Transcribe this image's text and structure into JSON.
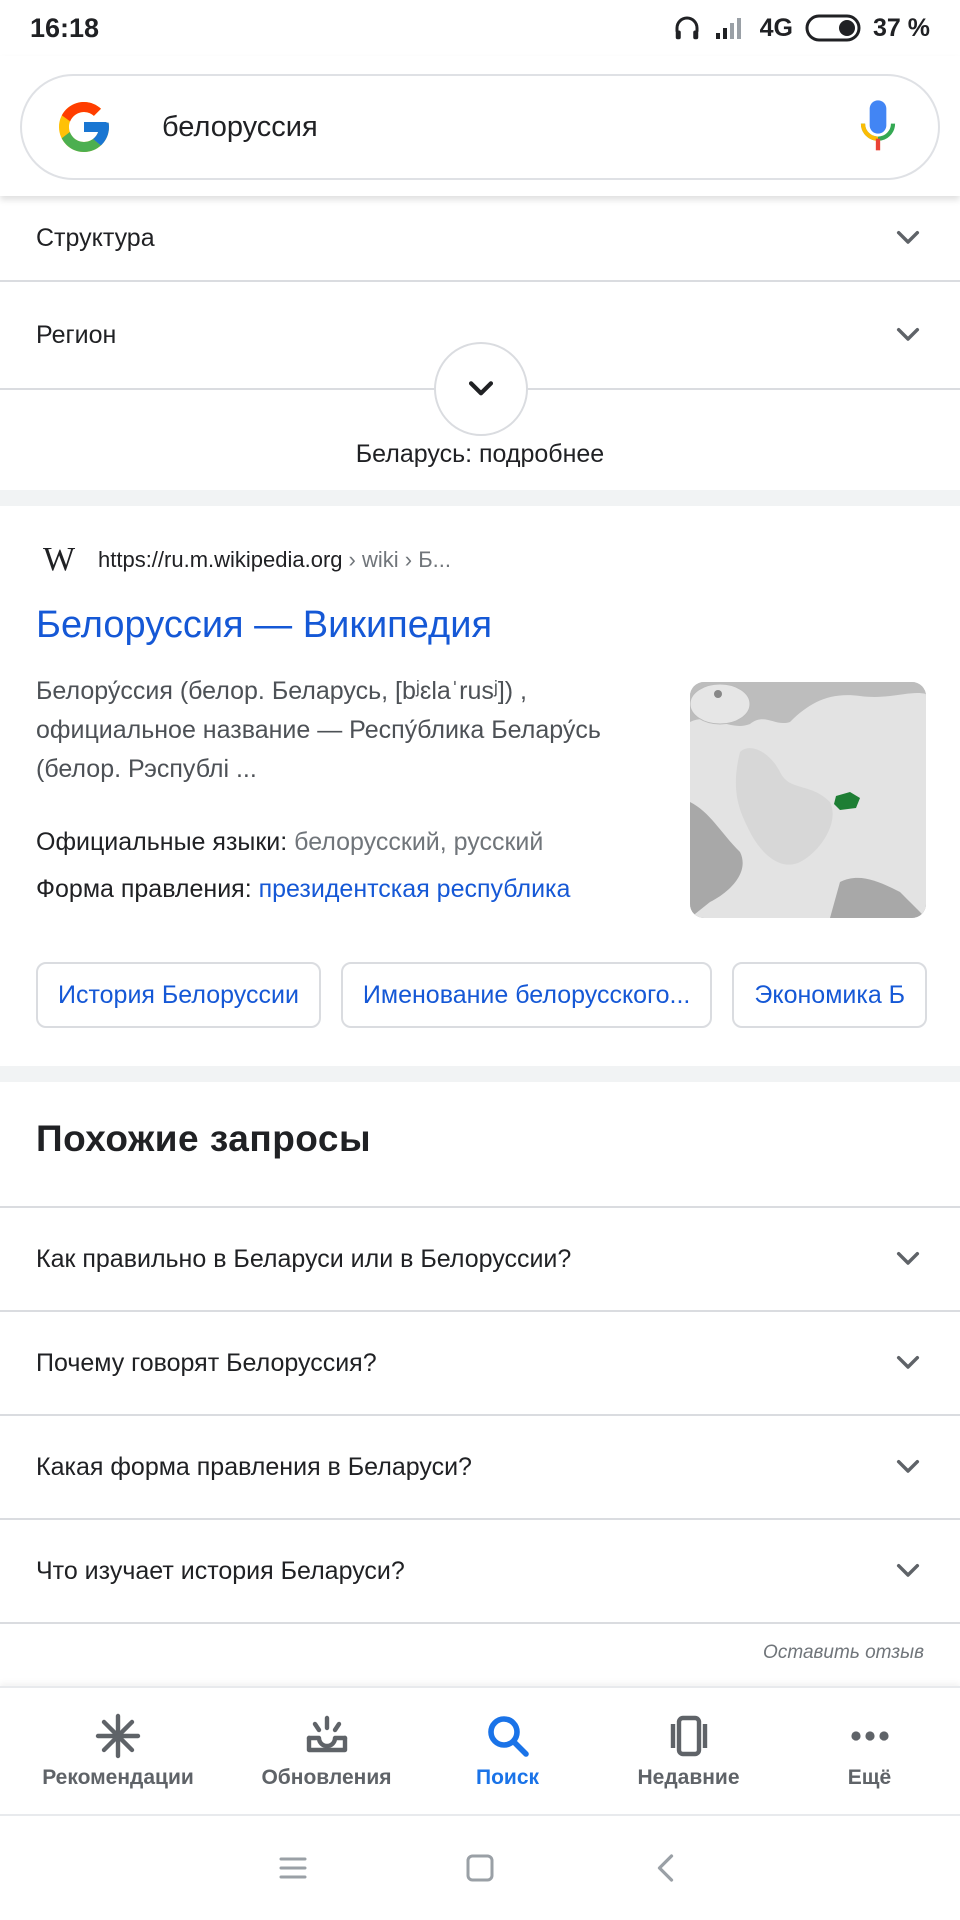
{
  "status": {
    "time": "16:18",
    "network": "4G",
    "battery": "37 %"
  },
  "search": {
    "query": "белоруссия"
  },
  "accordion_top": [
    {
      "label": "Структура"
    },
    {
      "label": "Регион"
    }
  ],
  "more_label": "Беларусь: подробнее",
  "wiki": {
    "logo_text": "W",
    "url_main": "https://ru.m.wikipedia.org",
    "url_path": "› wiki › Б...",
    "title": "Белоруссия — Википедия",
    "snippet": "Белору́ссия (белор. Беларусь, [bʲɛlaˈrusʲ]) , официальное название — Респу́блика Белару́сь (белор. Рэспублі ...",
    "fact1_label": "Официальные языки: ",
    "fact1_value": "белорусский, русский",
    "fact2_label": "Форма правления: ",
    "fact2_value": "президентская республика",
    "chips": [
      "История Белоруссии",
      "Именование белорусского...",
      "Экономика Б"
    ]
  },
  "related": {
    "title": "Похожие запросы",
    "items": [
      {
        "label": "Как правильно в Беларуси или в Белоруссии?"
      },
      {
        "label": "Почему говорят Белоруссия?"
      },
      {
        "label": "Какая форма правления в Беларуси?"
      },
      {
        "label": "Что изучает история Беларуси?"
      }
    ]
  },
  "feedback": "Оставить отзыв",
  "bottom_nav": {
    "items": [
      {
        "label": "Рекомендации"
      },
      {
        "label": "Обновления"
      },
      {
        "label": "Поиск"
      },
      {
        "label": "Недавние"
      },
      {
        "label": "Ещё"
      }
    ],
    "active_color": "#1a73e8"
  }
}
